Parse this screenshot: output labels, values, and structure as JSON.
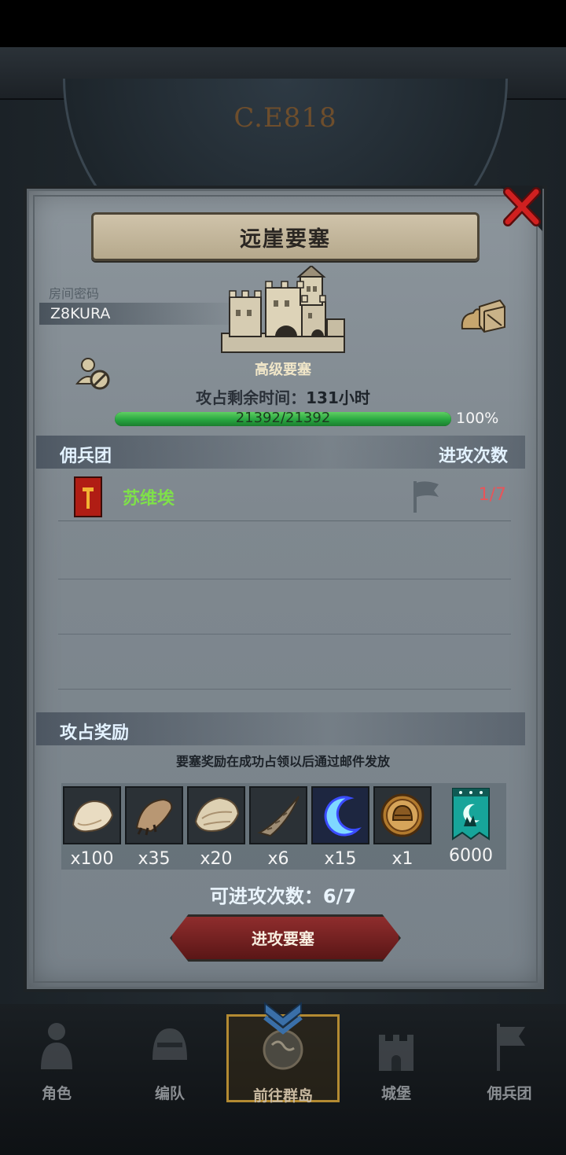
{
  "background": {
    "year": "C.E818"
  },
  "panel": {
    "title": "远崖要塞",
    "room_label": "房间密码",
    "room_code": "Z8KURA",
    "fort_level": "高级要塞",
    "time_label": "攻占剩余时间：",
    "time_value": "131小时",
    "hp_text": "21392/21392",
    "hp_percent_text": "100%",
    "hp_fraction": 1.0
  },
  "legion_section": {
    "title": "佣兵团",
    "right_title": "进攻次数",
    "rows": [
      {
        "name": "苏维埃",
        "count": "1/7"
      }
    ]
  },
  "reward_section": {
    "title": "攻占奖励",
    "note": "要塞奖励在成功占领以后通过邮件发放",
    "items": [
      {
        "icon": "fur-pelt-icon",
        "qty": "x100"
      },
      {
        "icon": "claw-icon",
        "qty": "x35"
      },
      {
        "icon": "hide-icon",
        "qty": "x20"
      },
      {
        "icon": "horn-icon",
        "qty": "x6"
      },
      {
        "icon": "crescent-blade-icon",
        "qty": "x15"
      },
      {
        "icon": "knight-helmet-coin-icon",
        "qty": "x1"
      },
      {
        "icon": "guild-banner-icon",
        "qty": "6000"
      }
    ]
  },
  "attempts_text": "可进攻次数：6/7",
  "attack_button": "进攻要塞",
  "nav": {
    "items": [
      {
        "label": "角色"
      },
      {
        "label": "编队"
      },
      {
        "label": "前往群岛"
      },
      {
        "label": "城堡"
      },
      {
        "label": "佣兵团"
      }
    ]
  },
  "colors": {
    "hp_green": "#28a640",
    "legion_name": "#7fe04a",
    "attack_count": "#e7555a",
    "close_red": "#d02020"
  }
}
